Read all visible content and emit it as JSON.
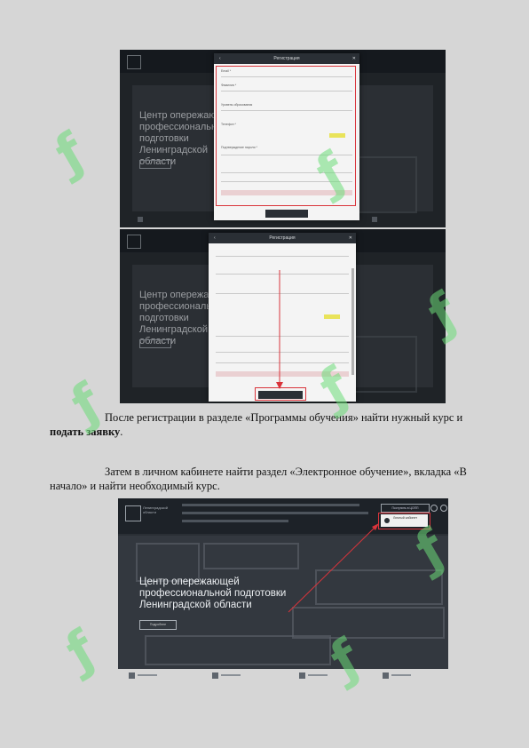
{
  "screenshot1": {
    "modal_title": "Регистрация",
    "highlight_color": "#d9343b",
    "field_labels": [
      "Email *",
      "Фамилия *",
      "Уровень образования",
      "Телефон *",
      "Подтверждение пароля *"
    ],
    "hero_title": "Центр опережающей профессиональной подготовки Ленинградской области"
  },
  "screenshot2": {
    "modal_title": "Регистрация",
    "hero_title": "Центр опережающей профессиональной подготовки Ленинградской области"
  },
  "paragraph1": {
    "text_before": "После регистрации в разделе «Программы обучения» найти нужный курс и ",
    "bold": "подать заявку",
    "text_after": "."
  },
  "paragraph2": {
    "text": "Затем в личном кабинете найти раздел «Электронное обучение», вкладка «В начало» и найти необходимый курс."
  },
  "screenshot3": {
    "logo_text": "Ленинградской области",
    "donate_label": "Поступить в ЦОПП",
    "cabinet_label": "Личный кабинет",
    "hero_title": "Центр опережающей профессиональной подготовки Ленинградской области",
    "hero_button": "Подробнее"
  },
  "colors": {
    "page_bg": "#d6d6d6",
    "dark_ui": "#2a2f35",
    "accent_red": "#d9343b",
    "watermark_green": "#6cdc78"
  }
}
